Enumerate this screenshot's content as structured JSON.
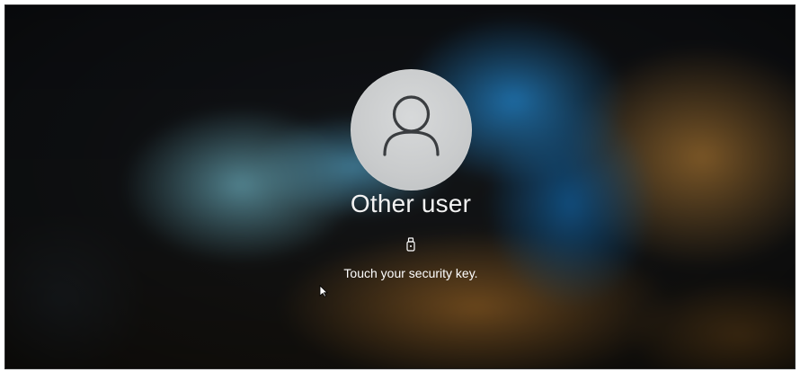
{
  "login": {
    "user_name": "Other user",
    "prompt": "Touch your security key.",
    "avatar_icon": "user-silhouette-icon",
    "security_key_icon": "usb-security-key-icon"
  }
}
